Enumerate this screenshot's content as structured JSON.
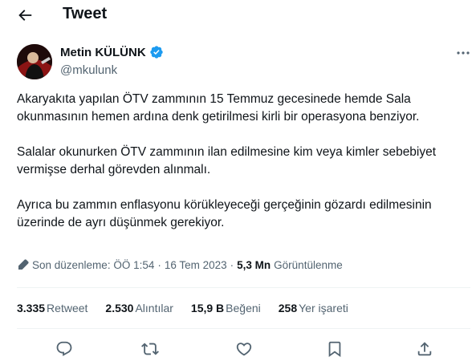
{
  "header": {
    "title": "Tweet",
    "back_icon": "back-arrow-icon"
  },
  "author": {
    "name": "Metin KÜLÜNK",
    "handle": "@mkulunk",
    "verified_color": "#1d9bf0"
  },
  "tweet": {
    "paragraphs": [
      "Akaryakıta yapılan ÖTV zammının 15 Temmuz gecesinede hemde Sala okunmasının hemen ardına denk getirilmesi kirli bir operasyona benziyor.",
      "Salalar okunurken ÖTV zammının ilan edilmesine kim veya kimler sebebiyet vermişse derhal görevden alınmalı.",
      "Ayrıca bu zammın enflasyonu körükleyeceği gerçeğinin gözardı edilmesinin üzerinde de ayrı düşünmek gerekiyor."
    ]
  },
  "meta": {
    "edited_label": "Son düzenleme: ÖÖ 1:54",
    "date": "16 Tem 2023",
    "views_count": "5,3 Mn",
    "views_label": "Görüntülenme"
  },
  "stats": [
    {
      "count": "3.335",
      "label": "Retweet"
    },
    {
      "count": "2.530",
      "label": "Alıntılar"
    },
    {
      "count": "15,9 B",
      "label": "Beğeni"
    },
    {
      "count": "258",
      "label": "Yer işareti"
    }
  ],
  "actions": [
    "reply-icon",
    "retweet-icon",
    "like-icon",
    "bookmark-icon",
    "share-icon"
  ],
  "colors": {
    "text": "#0f1419",
    "secondary": "#536471",
    "accent": "#1d9bf0",
    "divider": "#eff3f4"
  }
}
